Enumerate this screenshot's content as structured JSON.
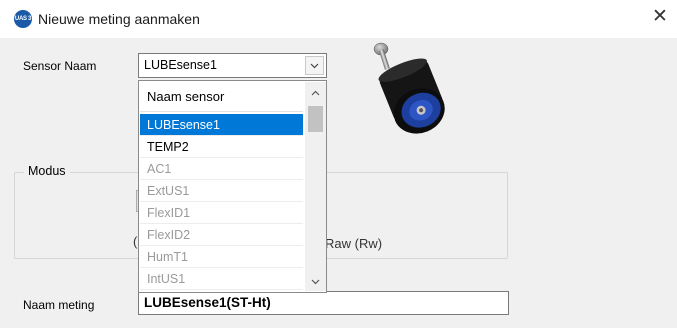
{
  "window": {
    "title": "Nieuwe meting aanmaken",
    "icon_text": "UAS 3",
    "close_symbol": "✕"
  },
  "form": {
    "sensor_naam_label": "Sensor Naam",
    "sensor_naam_value": "LUBEsense1",
    "modus_label": "Modus",
    "radio_fragment": "(",
    "raw_label": "Raw (Rw)",
    "naam_meting_label": "Naam meting",
    "naam_meting_value": "LUBEsense1(ST-Ht)"
  },
  "dropdown": {
    "header": "Naam sensor",
    "items": [
      {
        "label": "LUBEsense1",
        "state": "selected"
      },
      {
        "label": "TEMP2",
        "state": "enabled"
      },
      {
        "label": "AC1",
        "state": "disabled"
      },
      {
        "label": "ExtUS1",
        "state": "disabled"
      },
      {
        "label": "FlexID1",
        "state": "disabled"
      },
      {
        "label": "FlexID2",
        "state": "disabled"
      },
      {
        "label": "HumT1",
        "state": "disabled"
      },
      {
        "label": "IntUS1",
        "state": "disabled"
      }
    ]
  },
  "icons": {
    "combo_arrow": "chevron-down-icon",
    "scroll_up": "chevron-up-icon",
    "scroll_down": "chevron-down-icon",
    "sensor": "sensor-device-icon"
  },
  "colors": {
    "selection": "#0078d7",
    "dialog_bg": "#f0f0f0",
    "app_icon": "#1a5aa8",
    "disabled_text": "#9a9a9a"
  }
}
